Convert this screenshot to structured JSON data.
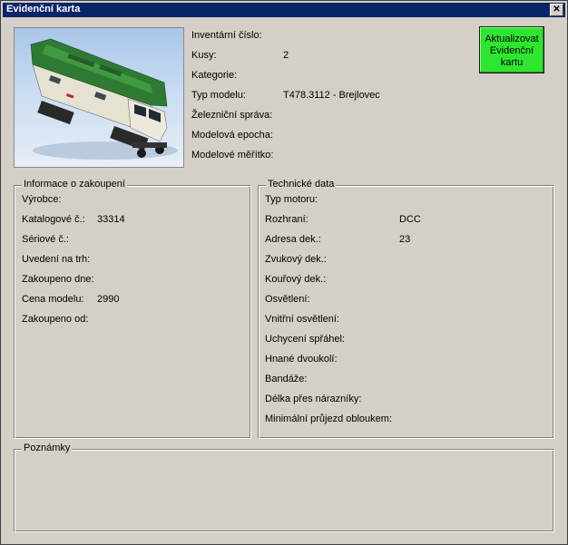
{
  "window": {
    "title": "Evidenční karta",
    "close_glyph": "✕"
  },
  "header_fields": [
    {
      "label": "Inventární číslo:",
      "value": ""
    },
    {
      "label": "Kusy:",
      "value": "2"
    },
    {
      "label": "Kategorie:",
      "value": ""
    },
    {
      "label": "Typ modelu:",
      "value": "T478.3112 - Brejlovec"
    },
    {
      "label": "Železniční správa:",
      "value": ""
    },
    {
      "label": "Modelová epocha:",
      "value": ""
    },
    {
      "label": "Modelové měřítko:",
      "value": ""
    }
  ],
  "update_button": {
    "label": "Aktualizovat Evidenční kartu",
    "color": "#2fe62f"
  },
  "purchase": {
    "legend": "Informace o zakoupení",
    "fields": [
      {
        "label": "Výrobce:",
        "value": ""
      },
      {
        "label": "Katalogové č.:",
        "value": "33314"
      },
      {
        "label": "Sériové č.:",
        "value": ""
      },
      {
        "label": "Uvedení na trh:",
        "value": ""
      },
      {
        "label": "Zakoupeno dne:",
        "value": ""
      },
      {
        "label": "Cena modelu:",
        "value": "2990"
      },
      {
        "label": "Zakoupeno od:",
        "value": ""
      }
    ]
  },
  "technical": {
    "legend": "Technické data",
    "fields": [
      {
        "label": "Typ motoru:",
        "value": ""
      },
      {
        "label": "Rozhraní:",
        "value": "DCC"
      },
      {
        "label": "Adresa dek.:",
        "value": "23"
      },
      {
        "label": "Zvukový dek.:",
        "value": ""
      },
      {
        "label": "Kouřový dek.:",
        "value": ""
      },
      {
        "label": "Osvětlení:",
        "value": ""
      },
      {
        "label": "Vnitřní osvětlení:",
        "value": ""
      },
      {
        "label": "Uchycení spřáhel:",
        "value": ""
      },
      {
        "label": "Hnané dvoukolí:",
        "value": ""
      },
      {
        "label": "Bandáže:",
        "value": ""
      },
      {
        "label": "Délka přes nárazníky:",
        "value": ""
      },
      {
        "label": "Minimální průjezd obloukem:",
        "value": ""
      }
    ]
  },
  "notes": {
    "legend": "Poznámky",
    "text": ""
  }
}
